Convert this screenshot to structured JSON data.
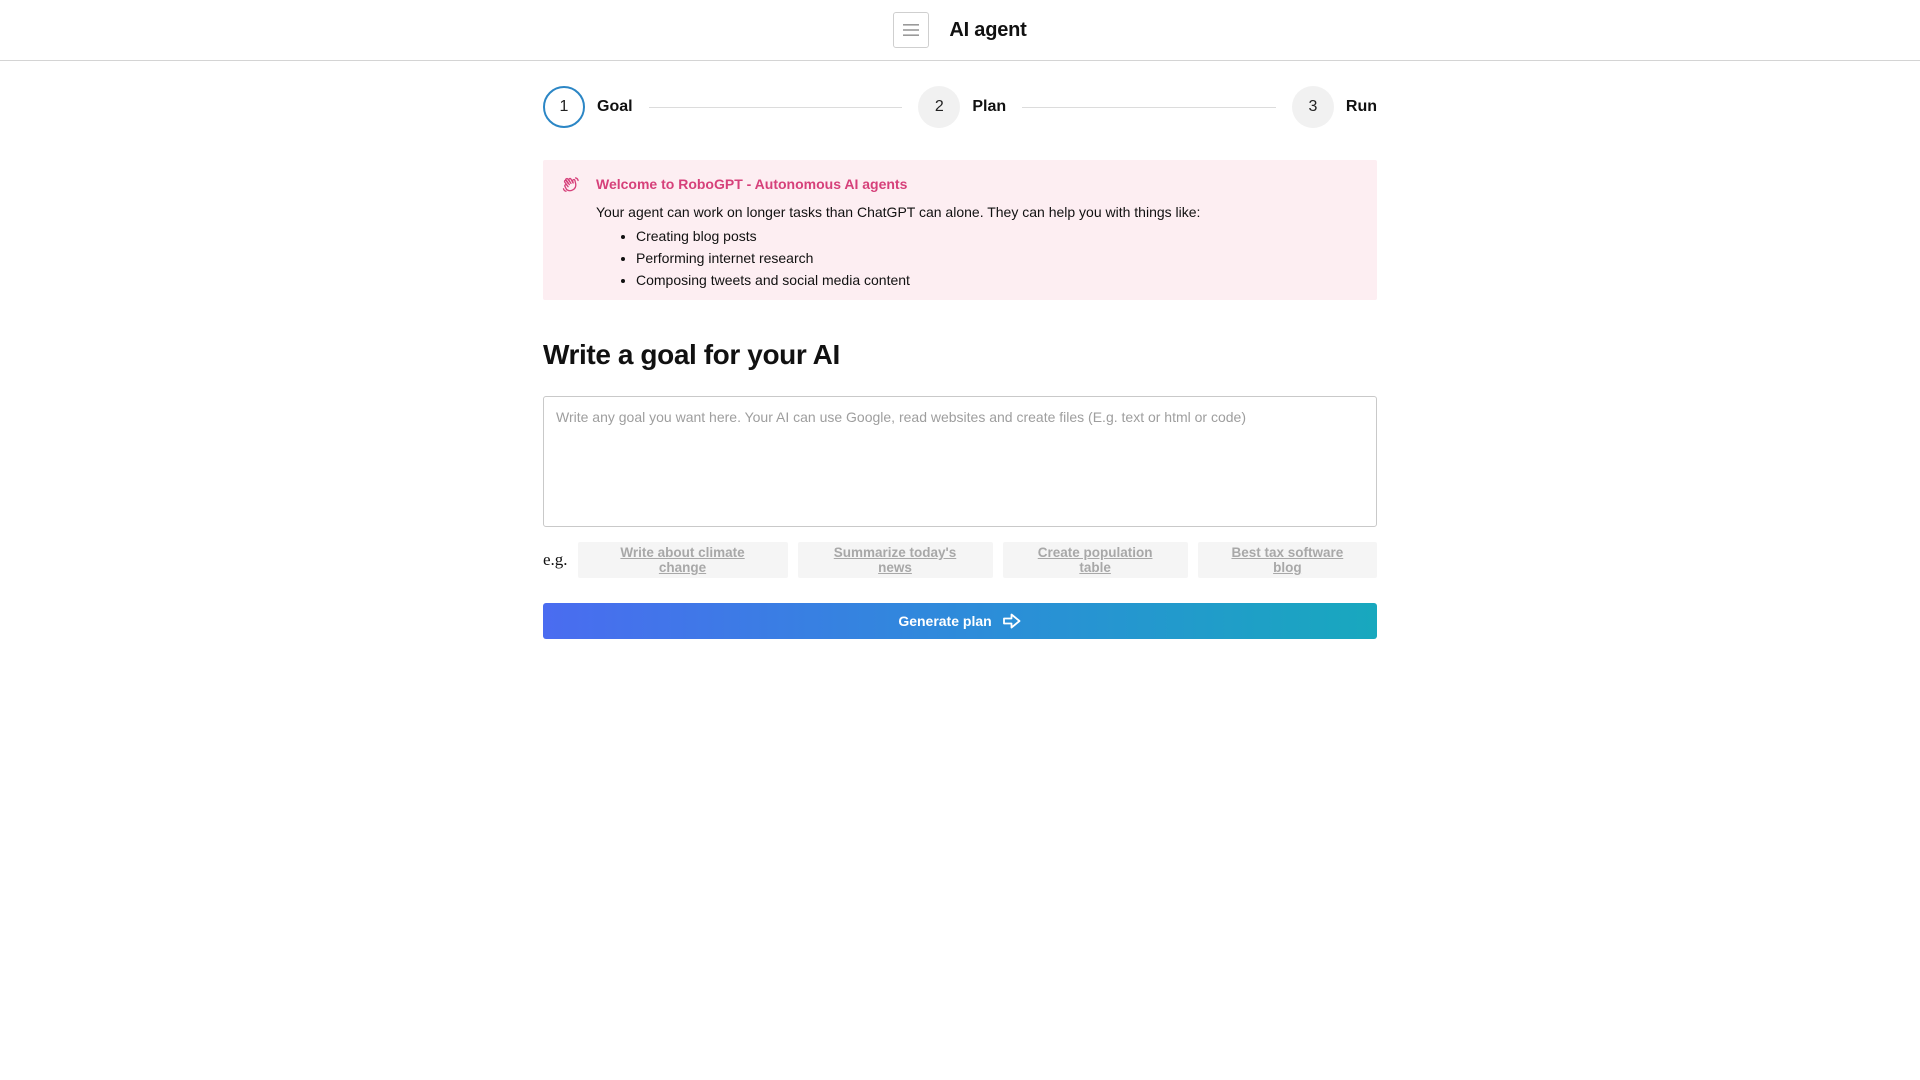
{
  "header": {
    "title": "AI agent",
    "menu_icon": "hamburger-menu-icon"
  },
  "stepper": {
    "steps": [
      {
        "number": "1",
        "label": "Goal",
        "active": true
      },
      {
        "number": "2",
        "label": "Plan",
        "active": false
      },
      {
        "number": "3",
        "label": "Run",
        "active": false
      }
    ]
  },
  "notice": {
    "icon": "waving-hand-icon",
    "title": "Welcome to RoboGPT - Autonomous AI agents",
    "intro": "Your agent can work on longer tasks than ChatGPT can alone. They can help you with things like:",
    "items": [
      "Creating blog posts",
      "Performing internet research",
      "Composing tweets and social media content"
    ]
  },
  "goal": {
    "heading": "Write a goal for your AI",
    "value": "",
    "placeholder": "Write any goal you want here. Your AI can use Google, read websites and create files (E.g. text or html or code)"
  },
  "examples": {
    "prefix": "e.g.",
    "chips": [
      "Write about climate change",
      "Summarize today's news",
      "Create population table",
      "Best tax software blog"
    ]
  },
  "actions": {
    "generate_label": "Generate plan",
    "generate_icon": "arrow-right-icon"
  },
  "colors": {
    "accent_pink": "#d6407a",
    "notice_bg": "#fdeef2",
    "active_step_border": "#2b86c5",
    "button_gradient_start": "#4a6cf0",
    "button_gradient_end": "#18a8be"
  }
}
